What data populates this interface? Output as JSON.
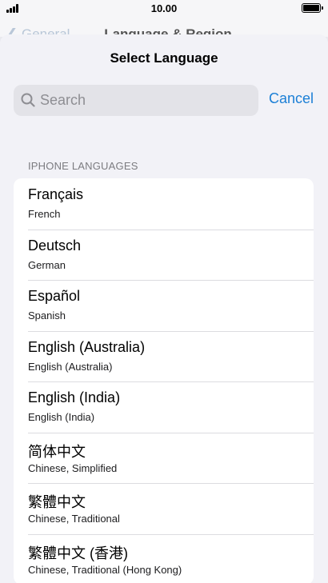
{
  "status_bar": {
    "time": "10.00",
    "icons": [
      "signal-icon",
      "battery-icon"
    ]
  },
  "background_nav": {
    "back_label": "General",
    "title": "Language & Region"
  },
  "sheet": {
    "title": "Select Language",
    "search": {
      "placeholder": "Search",
      "value": ""
    },
    "cancel_label": "Cancel",
    "section_header": "IPHONE LANGUAGES",
    "languages": [
      {
        "name": "Français",
        "subtitle": "French"
      },
      {
        "name": "Deutsch",
        "subtitle": "German"
      },
      {
        "name": "Español",
        "subtitle": "Spanish"
      },
      {
        "name": "English (Australia)",
        "subtitle": "English (Australia)"
      },
      {
        "name": "English (India)",
        "subtitle": "English (India)"
      },
      {
        "name": "简体中文",
        "subtitle": "Chinese, Simplified"
      },
      {
        "name": "繁體中文",
        "subtitle": "Chinese, Traditional"
      },
      {
        "name": "繁體中文 (香港)",
        "subtitle": "Chinese, Traditional (Hong Kong)"
      }
    ]
  },
  "colors": {
    "accent": "#1b7fd6",
    "sheet_background": "#f2f2f7",
    "search_field": "#e3e3e8",
    "secondary_text": "#7c7c80"
  }
}
